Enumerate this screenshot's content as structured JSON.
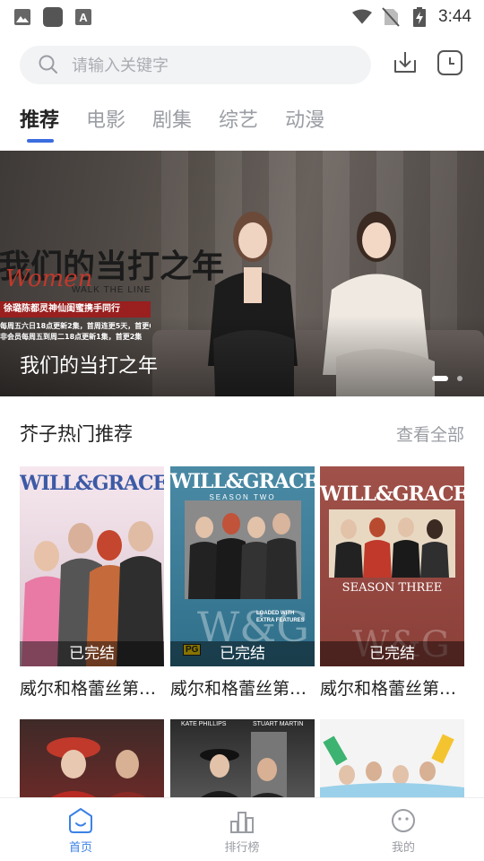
{
  "status_bar": {
    "time": "3:44",
    "icons": [
      "image-icon",
      "app-icon",
      "a-icon",
      "wifi-icon",
      "no-sim-icon",
      "battery-charging-icon"
    ]
  },
  "search": {
    "placeholder": "请输入关键字"
  },
  "toolbar": {
    "icons": [
      "download-icon",
      "history-icon"
    ]
  },
  "tabs": [
    {
      "label": "推荐",
      "active": true
    },
    {
      "label": "电影",
      "active": false
    },
    {
      "label": "剧集",
      "active": false
    },
    {
      "label": "综艺",
      "active": false
    },
    {
      "label": "动漫",
      "active": false
    }
  ],
  "banner": {
    "caption": "我们的当打之年",
    "poster_title": "我们的当打之年",
    "poster_subtitle": "Women",
    "poster_english": "WALK THE LINE",
    "poster_tagline": "徐璐陈都灵神仙闺蜜携手同行",
    "poster_schedule": [
      "每周五六日18点更新2集，首周连更5天，首更6集",
      "非会员每周五到周二18点更新1集，首更2集"
    ],
    "pages": 2,
    "current_page": 1
  },
  "section": {
    "title": "芥子热门推荐",
    "more": "查看全部"
  },
  "cards": [
    {
      "title": "威尔和格蕾丝第…",
      "status": "已完结",
      "logo": "WILL&GRACE",
      "season": "",
      "colors": [
        "#f6e7ee",
        "#d9c4cf"
      ]
    },
    {
      "title": "威尔和格蕾丝第…",
      "status": "已完结",
      "logo": "WILL&GRACE",
      "season": "SEASON TWO",
      "colors": [
        "#4a8aa5",
        "#2f6f8a"
      ]
    },
    {
      "title": "威尔和格蕾丝第…",
      "status": "已完结",
      "logo": "WILL&GRACE",
      "season": "SEASON THREE",
      "colors": [
        "#a0524a",
        "#8a3f38"
      ]
    }
  ],
  "poster_labels": {
    "loaded": "LOADED WITH EXTRA FEATURES",
    "rating": "PG",
    "wg": "W&G",
    "kate": "KATE PHILLIPS",
    "stuart": "STUART MARTIN"
  },
  "bottom_nav": [
    {
      "label": "首页",
      "icon": "home-icon",
      "active": true
    },
    {
      "label": "排行榜",
      "icon": "ranking-icon",
      "active": false
    },
    {
      "label": "我的",
      "icon": "profile-icon",
      "active": false
    }
  ],
  "colors": {
    "accent": "#3b6de0",
    "nav_active": "#3b82e6",
    "muted": "#9a9da3"
  }
}
